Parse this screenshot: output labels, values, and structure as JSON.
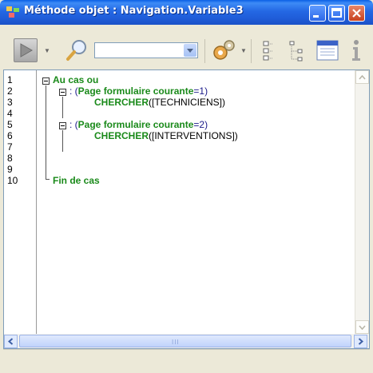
{
  "window": {
    "title": "Méthode objet : Navigation.Variable3",
    "colors": {
      "titlebar": "#2468e4",
      "keyword": "#1a8a1a",
      "close": "#c7401d"
    }
  },
  "toolbar": {
    "items": [
      {
        "name": "run-method-button",
        "icon": "play-icon"
      },
      {
        "name": "find-button",
        "icon": "magnifier-icon"
      },
      {
        "name": "search-combo",
        "value": ""
      },
      {
        "name": "macros-button",
        "icon": "gears-icon"
      },
      {
        "name": "collapse-button",
        "icon": "collapse-tree-icon"
      },
      {
        "name": "expand-button",
        "icon": "expand-tree-icon"
      },
      {
        "name": "list-button",
        "icon": "list-panel-icon"
      },
      {
        "name": "info-button",
        "icon": "info-icon"
      }
    ]
  },
  "editor": {
    "line_numbers": [
      "1",
      "2",
      "3",
      "4",
      "5",
      "6",
      "7",
      "8",
      "9",
      "10"
    ],
    "lines": {
      "l1_kw": "Au cas ou",
      "l2_prefix": ": (",
      "l2_kw": "Page formulaire courante",
      "l2_suffix": "=1)",
      "l3_kw": "CHERCHER",
      "l3_arg": "([TECHNICIENS])",
      "l5_prefix": ": (",
      "l5_kw": "Page formulaire courante",
      "l5_suffix": "=2)",
      "l6_kw": "CHERCHER",
      "l6_arg": "([INTERVENTIONS])",
      "l8_kw": "Fin de cas"
    }
  },
  "scrollbar": {
    "grip": "III"
  }
}
